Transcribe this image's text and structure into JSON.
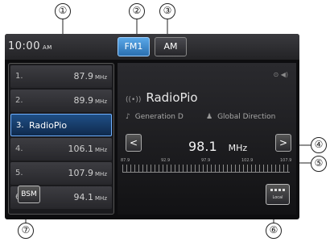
{
  "callouts": [
    "①",
    "②",
    "③",
    "④",
    "⑤",
    "⑥",
    "⑦"
  ],
  "clock": {
    "time": "10:00",
    "ampm": "AM"
  },
  "bands": {
    "fm": "FM1",
    "am": "AM"
  },
  "presets": [
    {
      "num": "1.",
      "freq": "87.9",
      "unit": "MHz"
    },
    {
      "num": "2.",
      "freq": "89.9",
      "unit": "MHz"
    },
    {
      "num": "3.",
      "name": "RadioPio"
    },
    {
      "num": "4.",
      "freq": "106.1",
      "unit": "MHz"
    },
    {
      "num": "5.",
      "freq": "107.9",
      "unit": "MHz"
    },
    {
      "num": "6.",
      "freq": "94.1",
      "unit": "MHz"
    }
  ],
  "station": {
    "name": "RadioPio",
    "genre": "Generation D",
    "artist": "Global Direction"
  },
  "tuner": {
    "frequency": "98.1",
    "unit": "MHz",
    "prev": "<",
    "next": ">"
  },
  "scale_labels": [
    "87.9",
    "92.9",
    "97.9",
    "102.9",
    "107.9"
  ],
  "buttons": {
    "bsm": "BSM",
    "local": "Local"
  }
}
